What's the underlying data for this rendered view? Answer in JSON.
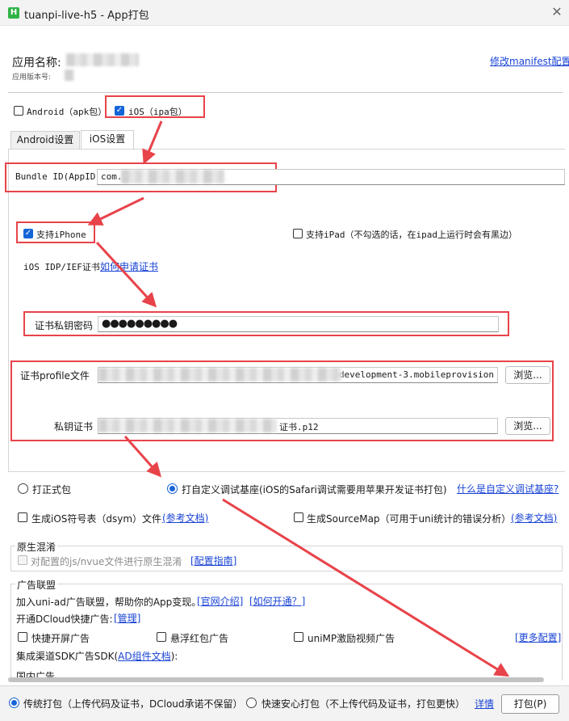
{
  "window": {
    "title": "tuanpi-live-h5 - App打包",
    "app_icon": "H",
    "close_symbol": "✕"
  },
  "header": {
    "app_name_label": "应用名称:",
    "version_label": "应用版本号:",
    "manifest_link": "修改manifest配置"
  },
  "platforms": {
    "android_label": "Android（apk包）",
    "android_checked": false,
    "ios_label": "iOS（ipa包）",
    "ios_checked": true
  },
  "tabs": [
    {
      "label": "Android设置",
      "active": false
    },
    {
      "label": "iOS设置",
      "active": true
    }
  ],
  "ios": {
    "bundle_id_label": "Bundle ID(AppID)",
    "bundle_id_value": "com.",
    "support_iphone_label": "支持iPhone",
    "support_iphone_checked": true,
    "support_ipad_label": "支持iPad（不勾选的话，在ipad上运行时会有黑边）",
    "support_ipad_checked": false,
    "cert_label": "iOS IDP/IEF证书",
    "cert_link": "如何申请证书",
    "password_label": "证书私钥密码",
    "password_value": "●●●●●●●●●",
    "profile_label": "证书profile文件",
    "profile_value": "development-3.mobileprovision",
    "private_key_label": "私钥证书",
    "private_key_value": "证书.p12",
    "browse_label": "浏览..."
  },
  "build_type": {
    "formal_label": "打正式包",
    "formal_checked": false,
    "custom_label": "打自定义调试基座(iOS的Safari调试需要用苹果开发证书打包)",
    "custom_checked": true,
    "custom_link": "什么是自定义调试基座?"
  },
  "options": {
    "dsym_label": "生成iOS符号表（dsym）文件",
    "dsym_link": "(参考文档)",
    "sourcemap_label": "生成SourceMap（可用于uni统计的错误分析）",
    "sourcemap_link": "(参考文档)"
  },
  "obfuscation": {
    "title": "原生混淆",
    "checkbox_label": "对配置的js/nvue文件进行原生混淆",
    "link": "[配置指南]"
  },
  "ads": {
    "title": "广告联盟",
    "intro_text": "加入uni-ad广告联盟，帮助你的App变现。",
    "intro_link1": "[官网介绍]",
    "intro_link2": "[如何开通？]",
    "dcloud_label": "开通DCloud快捷广告:",
    "dcloud_link": "[管理]",
    "splash_label": "快捷开屏广告",
    "float_label": "悬浮红包广告",
    "video_label": "uniMP激励视频广告",
    "more_link": "[更多配置]",
    "sdk_label_pre": "集成渠道SDK广告SDK(",
    "sdk_link": "AD组件文档",
    "sdk_label_post": "):",
    "domestic_label": "国内广告"
  },
  "footer": {
    "traditional_label": "传统打包（上传代码及证书，DCloud承诺不保留）",
    "traditional_checked": true,
    "secure_label": "快速安心打包（不上传代码及证书，打包更快）",
    "secure_checked": false,
    "details_link": "详情",
    "pack_button": "打包(P)"
  },
  "colors": {
    "accent": "#1565d8",
    "link": "#1a44d6",
    "annotation": "#e8434a"
  }
}
